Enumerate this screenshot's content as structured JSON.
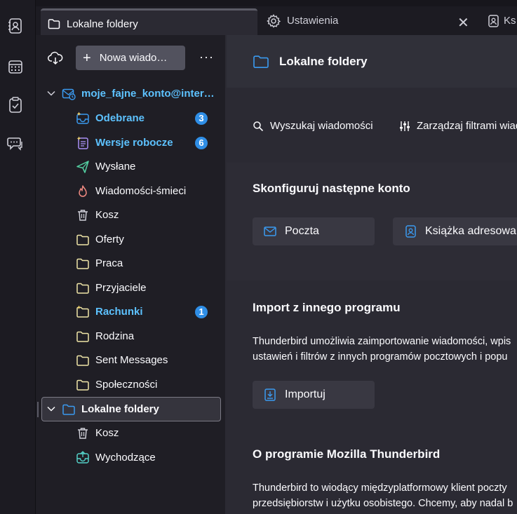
{
  "spaces": [
    {
      "name": "address-book",
      "icon": "address-book-icon"
    },
    {
      "name": "calendar",
      "icon": "calendar-icon"
    },
    {
      "name": "tasks",
      "icon": "tasks-icon"
    },
    {
      "name": "chat",
      "icon": "chat-icon"
    }
  ],
  "tabs": [
    {
      "label": "Lokalne foldery",
      "icon": "folder-icon",
      "active": true
    },
    {
      "label": "Ustawienia",
      "icon": "gear-icon",
      "active": false
    },
    {
      "label": "Ks",
      "icon": "address-book-icon",
      "active": false
    }
  ],
  "folder_pane": {
    "new_message_label": "Nowa wiado…",
    "more_label": "···",
    "account": {
      "label": "moje_fajne_konto@inter…"
    },
    "folders": [
      {
        "label": "Odebrane",
        "icon": "inbox-icon",
        "unread": 3
      },
      {
        "label": "Wersje robocze",
        "icon": "drafts-icon",
        "unread": 6
      },
      {
        "label": "Wysłane",
        "icon": "sent-icon"
      },
      {
        "label": "Wiadomości-śmieci",
        "icon": "junk-icon"
      },
      {
        "label": "Kosz",
        "icon": "trash-icon"
      },
      {
        "label": "Oferty",
        "icon": "folder-icon"
      },
      {
        "label": "Praca",
        "icon": "folder-icon"
      },
      {
        "label": "Przyjaciele",
        "icon": "folder-icon"
      },
      {
        "label": "Rachunki",
        "icon": "folder-icon",
        "unread": 1
      },
      {
        "label": "Rodzina",
        "icon": "folder-icon"
      },
      {
        "label": "Sent Messages",
        "icon": "folder-icon"
      },
      {
        "label": "Społeczności",
        "icon": "folder-icon"
      }
    ],
    "local": {
      "label": "Lokalne foldery",
      "folders": [
        {
          "label": "Kosz",
          "icon": "trash-icon"
        },
        {
          "label": "Wychodzące",
          "icon": "outbox-icon"
        }
      ]
    }
  },
  "content": {
    "title": "Lokalne foldery",
    "search_label": "Wyszukaj wiadomości",
    "filters_label": "Zarządzaj filtrami wiad",
    "setup": {
      "title": "Skonfiguruj następne konto",
      "mail_label": "Poczta",
      "addressbook_label": "Książka adresowa"
    },
    "import": {
      "title": "Import z innego programu",
      "line1": "Thunderbird umożliwia zaimportowanie wiadomości, wpis",
      "line2": "ustawień i filtrów z innych programów pocztowych i popu",
      "button_label": "Importuj"
    },
    "about": {
      "title": "O programie Mozilla Thunderbird",
      "line1": "Thunderbird to wiodący międzyplatformowy klient poczty",
      "line2": "przedsiębiorstw i użytku osobistego. Chcemy, aby nadal b"
    }
  },
  "colors": {
    "accent": "#5dc2ff",
    "badge": "#2f8ee6",
    "folder_icon": "#f0e6a8",
    "folder_blue": "#3a9af0"
  }
}
